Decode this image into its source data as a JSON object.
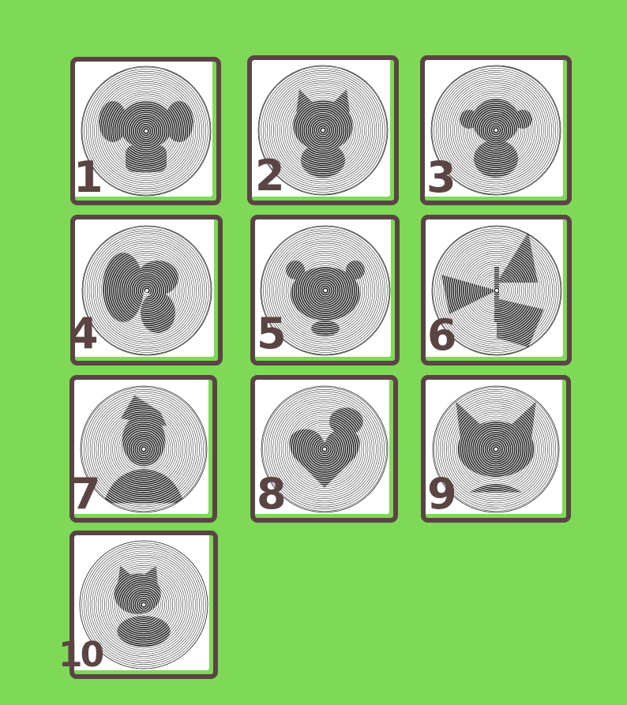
{
  "colors": {
    "background": "#7ed957",
    "frame": "#5a4444",
    "tile": "#ffffff",
    "line": "#2a2a2a"
  },
  "designs": [
    {
      "number": "1",
      "subject": "elephant-icon"
    },
    {
      "number": "2",
      "subject": "cat-icon"
    },
    {
      "number": "3",
      "subject": "monkey-icon"
    },
    {
      "number": "4",
      "subject": "squirrel-icon"
    },
    {
      "number": "5",
      "subject": "panda-icon"
    },
    {
      "number": "6",
      "subject": "butterfly-icon"
    },
    {
      "number": "7",
      "subject": "boy-portrait-icon"
    },
    {
      "number": "8",
      "subject": "heart-puppy-icon"
    },
    {
      "number": "9",
      "subject": "dog-face-icon"
    },
    {
      "number": "10",
      "subject": "kitten-icon"
    }
  ]
}
